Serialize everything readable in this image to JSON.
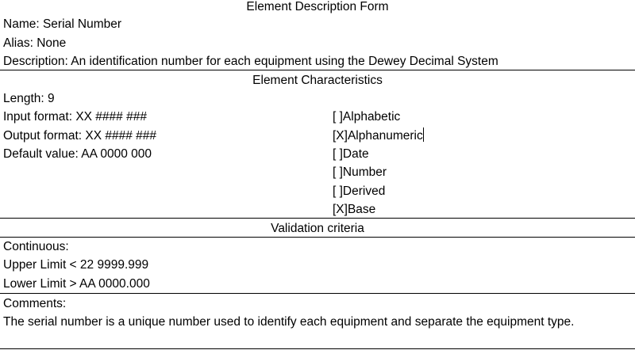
{
  "form": {
    "title": "Element Description Form",
    "name": "Name: Serial Number",
    "alias": "Alias: None",
    "description": "Description: An identification number for each equipment using the Dewey Decimal System"
  },
  "characteristics": {
    "heading": "Element Characteristics",
    "length": "Length: 9",
    "input_format": "Input format: XX #### ###",
    "output_format": "Output format: XX #### ###",
    "default_value": "Default value: AA 0000 000",
    "types": [
      "[ ]Alphabetic",
      "[X]Alphanumeric",
      "[ ]Date",
      "[ ]Number",
      "[ ]Derived",
      "[X]Base"
    ]
  },
  "validation": {
    "heading": "Validation criteria",
    "continuous": "Continuous:",
    "upper_limit": "Upper Limit < 22 9999.999",
    "lower_limit": "Lower Limit > AA 0000.000"
  },
  "comments": {
    "label": "Comments:",
    "text": "The serial number is a unique number used to identify each equipment and separate the equipment type."
  }
}
